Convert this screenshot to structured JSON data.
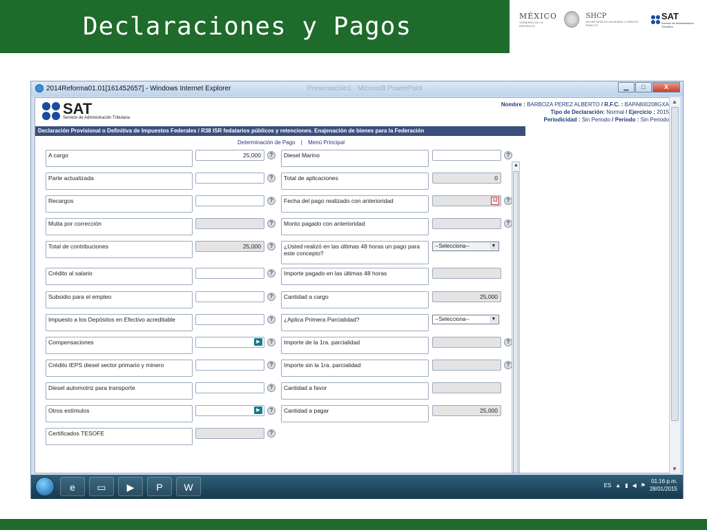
{
  "slide": {
    "title": "Declaraciones y Pagos",
    "logos": {
      "mexico": "MÉXICO",
      "mexico_sub": "GOBIERNO DE LA REPÚBLICA",
      "shcp": "SHCP",
      "shcp_sub": "SECRETARÍA DE HACIENDA Y CRÉDITO PÚBLICO",
      "sat": "SAT",
      "sat_sub": "Servicio de Administración Tributaria"
    }
  },
  "window": {
    "title": "2014Reforma01.01[161452657] - Windows Internet Explorer",
    "ghost_title": "Presentación1 - Microsoft PowerPoint",
    "buttons": {
      "minimize": "▁",
      "maximize": "□",
      "close": "X"
    }
  },
  "sat_page": {
    "logo_word": "SAT",
    "logo_sub": "Servicio de Administración Tributaria",
    "nombre_label": "Nombre :",
    "nombre": "BARBOZA PEREZ ALBERTO",
    "rfc_label": "/ R.F.C. :",
    "rfc": "BAPA800208GXA",
    "tipo_label": "Tipo de Declaración:",
    "tipo": "Normal",
    "ejercicio_label": "/ Ejercicio :",
    "ejercicio": "2015",
    "periodicidad_label": "Periodicidad :",
    "periodicidad": "Sin Periodo",
    "periodo_label": "/ Periodo :",
    "periodo": "Sin Periodo",
    "band_text": "Declaración Provisional o Definitiva de Impuestos Federales / R38 ISR fedatarios públicos y retenciones. Enajenación de bienes para la Federación",
    "nav_determinacion": "Determinación de Pago",
    "nav_sep": "|",
    "nav_menu": "Menú Principal"
  },
  "form": {
    "left": [
      {
        "label": "A cargo",
        "value": "25,000",
        "readonly": false
      },
      {
        "label": "Parte actualizada",
        "value": "",
        "readonly": false
      },
      {
        "label": "Recargos",
        "value": "",
        "readonly": false
      },
      {
        "label": "Multa por corrección",
        "value": "",
        "readonly": true
      },
      {
        "label": "Total de contribuciones",
        "value": "25,000",
        "readonly": true
      },
      {
        "label": "Crédito al salario",
        "value": "",
        "readonly": false
      },
      {
        "label": "Subsidio para el empleo",
        "value": "",
        "readonly": false
      },
      {
        "label": "Impuesto a los Depósitos en Efectivo acreditable",
        "value": "",
        "readonly": false
      },
      {
        "label": "Compensaciones",
        "value": "",
        "readonly": false
      },
      {
        "label": "Crédito IEPS diesel sector primario y minero",
        "value": "",
        "readonly": false
      },
      {
        "label": "Diesel automotriz para transporte",
        "value": "",
        "readonly": false
      },
      {
        "label": "Otros estímulos",
        "value": "",
        "readonly": false
      },
      {
        "label": "Certificados TESOFE",
        "value": "",
        "readonly": true
      }
    ],
    "right": [
      {
        "label": "Diesel Marino",
        "value": ""
      },
      {
        "label": "Total de aplicaciones",
        "value": "0"
      },
      {
        "label": "Fecha del pago realizado con anterioridad",
        "value": ""
      },
      {
        "label": "Monto pagado con anterioridad",
        "value": ""
      },
      {
        "label": "¿Usted realizó en las últimas 48 horas un pago para este concepto?",
        "value": "--Selecciona--"
      },
      {
        "label": "Importe pagado en las últimas 48 horas",
        "value": ""
      },
      {
        "label": "Cantidad a cargo",
        "value": "25,000"
      },
      {
        "label": "¿Aplica Primera Parcialidad?",
        "value": "--Selecciona--"
      },
      {
        "label": "Importe de la 1ra. parcialidad",
        "value": ""
      },
      {
        "label": "Importe sin la 1ra. parcialidad",
        "value": ""
      },
      {
        "label": "Cantidad a favor",
        "value": ""
      },
      {
        "label": "Cantidad a pagar",
        "value": "25,000"
      }
    ],
    "help_glyph": "?",
    "go_glyph": "▶",
    "calendar_glyph": "12",
    "caret_glyph": "▼"
  },
  "taskbar": {
    "lang": "ES",
    "time": "01:16 p.m.",
    "date": "28/01/2015",
    "icons": [
      "internet-explorer-icon",
      "folder-icon",
      "media-player-icon",
      "powerpoint-icon",
      "word-icon"
    ],
    "icon_glyphs": [
      "e",
      "▭",
      "▶",
      "P",
      "W"
    ]
  }
}
